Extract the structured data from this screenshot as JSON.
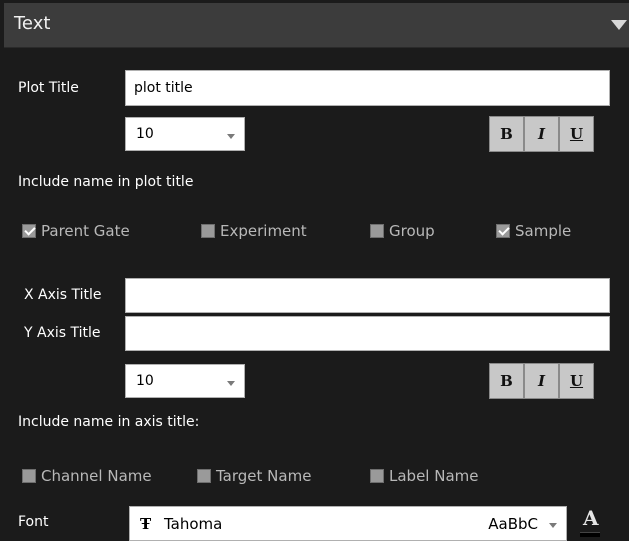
{
  "header": {
    "title": "Text"
  },
  "plot_title": {
    "label": "Plot Title",
    "value": "plot title",
    "font_size": "10"
  },
  "format_buttons": {
    "bold": "B",
    "italic": "I",
    "underline": "U"
  },
  "include_plot": {
    "label": "Include name in plot title",
    "options": [
      {
        "label": "Parent Gate",
        "checked": true
      },
      {
        "label": "Experiment",
        "checked": false
      },
      {
        "label": "Group",
        "checked": false
      },
      {
        "label": "Sample",
        "checked": true
      }
    ]
  },
  "axis": {
    "x_label": "X Axis Title",
    "x_value": "",
    "y_label": "Y Axis Title",
    "y_value": "",
    "font_size": "10"
  },
  "include_axis": {
    "label": "Include name in axis title:",
    "options": [
      {
        "label": "Channel Name",
        "checked": false
      },
      {
        "label": "Target Name",
        "checked": false
      },
      {
        "label": "Label Name",
        "checked": false
      }
    ]
  },
  "font": {
    "label": "Font",
    "glyph": "Ŧ",
    "name": "Tahoma",
    "preview": "AaBbC",
    "color_glyph": "A",
    "color": "#000000"
  }
}
